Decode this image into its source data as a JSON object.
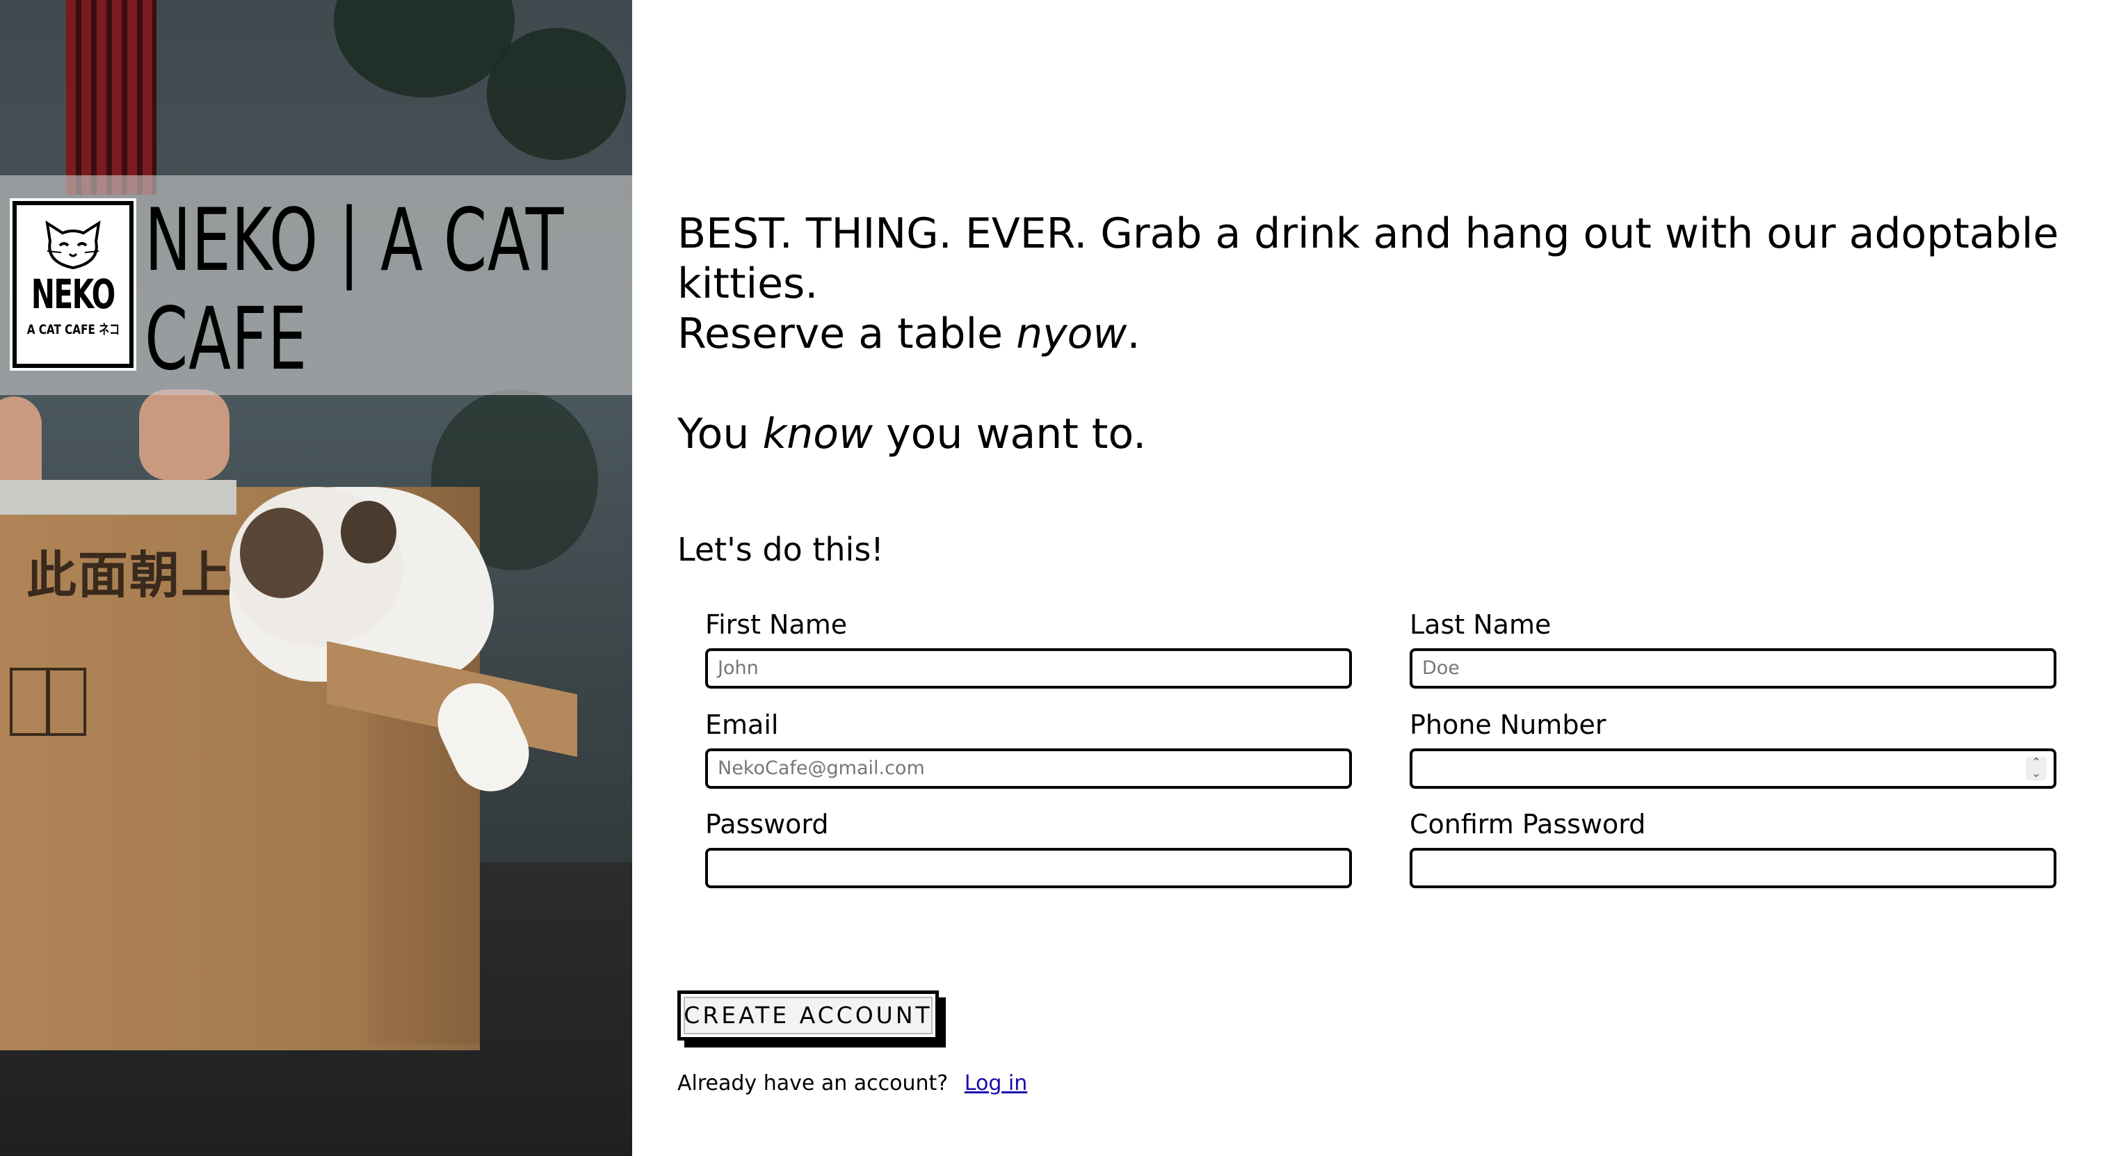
{
  "brand": {
    "logo_word": "NEKO",
    "logo_sub": "A CAT CAFE ネコ",
    "title_line1": "NEKO | A CAT",
    "title_line2": "CAFE"
  },
  "hero_box_text": "此面朝上",
  "intro": {
    "line1": "BEST. THING. EVER. Grab a drink and hang out with our adoptable kitties.",
    "line2_pre": "Reserve a table ",
    "line2_em": "nyow",
    "line2_post": ".",
    "line3_pre": "You ",
    "line3_em": "know",
    "line3_post": " you want to."
  },
  "form": {
    "heading": "Let's do this!",
    "fields": {
      "first_name": {
        "label": "First Name",
        "placeholder": "John"
      },
      "last_name": {
        "label": "Last Name",
        "placeholder": "Doe"
      },
      "email": {
        "label": "Email",
        "placeholder": "NekoCafe@gmail.com"
      },
      "phone": {
        "label": "Phone Number",
        "placeholder": ""
      },
      "password": {
        "label": "Password",
        "placeholder": ""
      },
      "confirm_password": {
        "label": "Confirm Password",
        "placeholder": ""
      }
    },
    "submit_label": "CREATE ACCOUNT",
    "login_prompt": "Already have an account?",
    "login_link": "Log in"
  },
  "colors": {
    "link": "#1a0dab",
    "band": "#c8c8c8"
  }
}
